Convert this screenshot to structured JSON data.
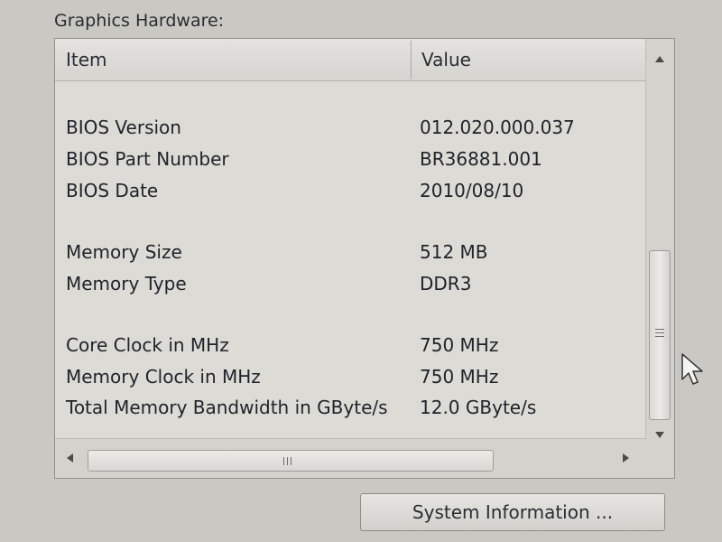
{
  "group": {
    "title": "Graphics Hardware:"
  },
  "table": {
    "columns": [
      "Item",
      "Value"
    ],
    "rows": [
      {
        "item": "BIOS Version",
        "value": "012.020.000.037"
      },
      {
        "item": "BIOS Part Number",
        "value": "BR36881.001"
      },
      {
        "item": "BIOS Date",
        "value": "2010/08/10"
      },
      {
        "item": "Memory Size",
        "value": "512 MB"
      },
      {
        "item": "Memory Type",
        "value": "DDR3"
      },
      {
        "item": "Core Clock in MHz",
        "value": "750 MHz"
      },
      {
        "item": "Memory Clock in MHz",
        "value": "750 MHz"
      },
      {
        "item": "Total Memory Bandwidth in GByte/s",
        "value": "12.0 GByte/s"
      }
    ]
  },
  "buttons": {
    "system_information": "System Information ..."
  },
  "icons": {
    "scroll_up": "scroll-up-arrow-icon",
    "scroll_down": "scroll-down-arrow-icon",
    "scroll_left": "scroll-left-arrow-icon",
    "scroll_right": "scroll-right-arrow-icon",
    "cursor": "mouse-pointer-icon"
  },
  "colors": {
    "background": "#c9c8c3",
    "list_background": "#dcdbd6",
    "text": "#1f2228"
  }
}
